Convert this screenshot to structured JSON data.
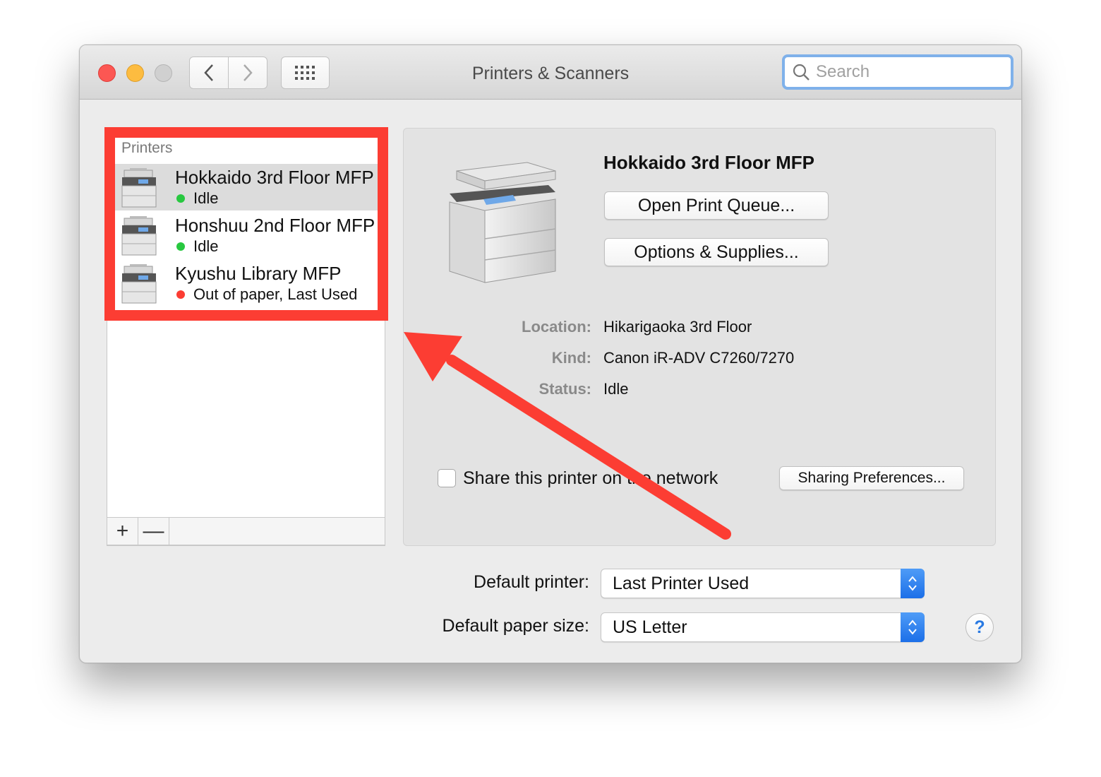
{
  "window": {
    "title": "Printers & Scanners"
  },
  "search": {
    "placeholder": "Search"
  },
  "printers_list": {
    "header": "Printers",
    "items": [
      {
        "name": "Hokkaido 3rd Floor MFP",
        "status": "Idle",
        "status_color": "#28c840",
        "selected": true
      },
      {
        "name": "Honshuu 2nd Floor MFP",
        "status": "Idle",
        "status_color": "#28c840",
        "selected": false
      },
      {
        "name": "Kyushu Library MFP",
        "status": "Out of paper, Last Used",
        "status_color": "#fc3d33",
        "selected": false
      }
    ],
    "add_label": "+",
    "remove_label": "—"
  },
  "detail": {
    "name": "Hokkaido 3rd Floor MFP",
    "open_queue_label": "Open Print Queue...",
    "options_label": "Options & Supplies...",
    "location_label": "Location:",
    "location_value": "Hikarigaoka 3rd Floor",
    "kind_label": "Kind:",
    "kind_value": "Canon iR-ADV C7260/7270",
    "status_label": "Status:",
    "status_value": "Idle",
    "share_label": "Share this printer on the network",
    "share_checked": false,
    "sharing_prefs_label": "Sharing Preferences..."
  },
  "defaults": {
    "printer_label": "Default printer:",
    "printer_value": "Last Printer Used",
    "paper_label": "Default paper size:",
    "paper_value": "US Letter"
  },
  "help": {
    "label": "?"
  },
  "annotation": {
    "color": "#fc3d33"
  }
}
